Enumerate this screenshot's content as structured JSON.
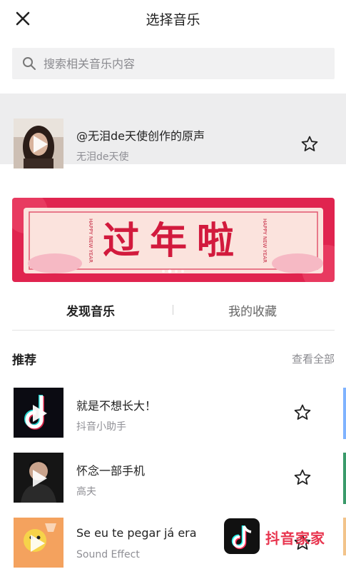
{
  "header": {
    "title": "选择音乐",
    "close_icon": "close-icon"
  },
  "search": {
    "placeholder": "搜索相关音乐内容",
    "value": ""
  },
  "current_sound": {
    "title": "@无泪de天使创作的原声",
    "author": "无泪de天使"
  },
  "banner": {
    "text": "过年啦",
    "side_text_left": "HAPPY NEW YEAR",
    "side_text_right": "HAPPY NEW YEAR",
    "page_count": 4,
    "active_page": 1
  },
  "tabs": [
    {
      "label": "发现音乐",
      "active": true
    },
    {
      "label": "我的收藏",
      "active": false
    }
  ],
  "recommend": {
    "title": "推荐",
    "see_all": "查看全部",
    "items": [
      {
        "title": "就是不想长大！",
        "artist": "抖音小助手"
      },
      {
        "title": "怀念一部手机",
        "artist": "高夫"
      },
      {
        "title": "Se eu te pegar já era",
        "artist": "Sound Effect"
      }
    ]
  },
  "watermark": {
    "text": "抖音家家"
  },
  "colors": {
    "accent": "#e8344e",
    "banner_bg": "#e0244f",
    "banner_panel": "#fbe3dd",
    "search_bg": "#f1f1f2",
    "selected_row_bg": "#ededee"
  }
}
